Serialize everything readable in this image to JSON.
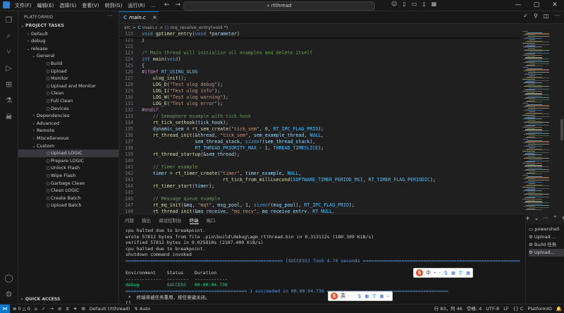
{
  "title_bar": {
    "menu": [
      "文件(F)",
      "编辑(E)",
      "选择(S)",
      "查看(V)",
      "转到(G)",
      "运行(R)",
      "..."
    ],
    "command_center": "rtthread"
  },
  "sidebar": {
    "title": "PLATFORMIO",
    "more": "···",
    "items": [
      {
        "label": "PROJECT TASKS",
        "chev": "⌄",
        "icon": "",
        "section": true
      },
      {
        "label": "Default",
        "chev": "›",
        "icon": ""
      },
      {
        "label": "debug",
        "chev": "›",
        "icon": ""
      },
      {
        "label": "release",
        "chev": "⌄",
        "icon": ""
      },
      {
        "label": "General",
        "chev": "⌄",
        "icon": ""
      },
      {
        "label": "Build",
        "chev": "",
        "icon": "○"
      },
      {
        "label": "Upload",
        "chev": "",
        "icon": "○"
      },
      {
        "label": "Monitor",
        "chev": "",
        "icon": "○"
      },
      {
        "label": "Upload and Monitor",
        "chev": "",
        "icon": "○"
      },
      {
        "label": "Clean",
        "chev": "",
        "icon": "○"
      },
      {
        "label": "Full Clean",
        "chev": "",
        "icon": "○"
      },
      {
        "label": "Devices",
        "chev": "",
        "icon": "○"
      },
      {
        "label": "Dependencies",
        "chev": "›",
        "icon": ""
      },
      {
        "label": "Advanced",
        "chev": "›",
        "icon": ""
      },
      {
        "label": "Remote",
        "chev": "›",
        "icon": ""
      },
      {
        "label": "Miscellaneous",
        "chev": "›",
        "icon": ""
      },
      {
        "label": "Custom",
        "chev": "⌄",
        "icon": ""
      },
      {
        "label": "Upload LOGIC",
        "chev": "",
        "icon": "○"
      },
      {
        "label": "Prepare LOGIC",
        "chev": "",
        "icon": "○"
      },
      {
        "label": "Unlock Flash",
        "chev": "",
        "icon": "○"
      },
      {
        "label": "Wipe Flash",
        "chev": "",
        "icon": "○"
      },
      {
        "label": "Garbage Clean",
        "chev": "",
        "icon": "○"
      },
      {
        "label": "Clean LOGIC",
        "chev": "",
        "icon": "○"
      },
      {
        "label": "Create Batch",
        "chev": "",
        "icon": "○"
      },
      {
        "label": "Upload Batch",
        "chev": "",
        "icon": "○"
      }
    ],
    "selected_index": 17,
    "quick_access": "QUICK ACCESS"
  },
  "editor": {
    "tab_label": "main.c",
    "tab_icon": "C",
    "tab_close": "×",
    "breadcrumb": {
      "folder": "src",
      "sep": ">",
      "file": "main.c",
      "symbol": "mq_receive_entry(void *)"
    },
    "lines": [
      {
        "n": "115",
        "segs": [
          [
            "kw",
            "void "
          ],
          [
            "fn",
            "gptimer_entry"
          ],
          [
            "tx",
            "("
          ],
          [
            "kw",
            "void "
          ],
          [
            "tx",
            "*"
          ],
          [
            "var",
            "parameter"
          ],
          [
            "tx",
            ")"
          ]
        ]
      },
      {
        "n": "121",
        "segs": [
          [
            "tx",
            "}"
          ]
        ]
      },
      {
        "n": "122",
        "segs": []
      },
      {
        "n": "123",
        "segs": [
          [
            "cm",
            "/* Main thread will initialize all examples and delete itself"
          ]
        ]
      },
      {
        "n": "124",
        "segs": [
          [
            "kw",
            "int "
          ],
          [
            "fn",
            "main"
          ],
          [
            "tx",
            "("
          ],
          [
            "kw",
            "void"
          ],
          [
            "tx",
            ")"
          ]
        ]
      },
      {
        "n": "125",
        "segs": [
          [
            "tx",
            "{"
          ]
        ]
      },
      {
        "n": "126",
        "segs": [
          [
            "pp",
            "#ifdef "
          ],
          [
            "mac",
            "RT_USING_ULOG"
          ]
        ]
      },
      {
        "n": "127",
        "segs": [
          [
            "tx",
            "    "
          ],
          [
            "fn",
            "ulog_init"
          ],
          [
            "tx",
            "();"
          ]
        ]
      },
      {
        "n": "128",
        "segs": [
          [
            "tx",
            "    "
          ],
          [
            "fn",
            "LOG_D"
          ],
          [
            "tx",
            "("
          ],
          [
            "str",
            "\"Test ulog debug\""
          ],
          [
            "tx",
            ");"
          ]
        ]
      },
      {
        "n": "129",
        "segs": [
          [
            "tx",
            "    "
          ],
          [
            "fn",
            "LOG_I"
          ],
          [
            "tx",
            "("
          ],
          [
            "str",
            "\"Test ulog info\""
          ],
          [
            "tx",
            ");"
          ]
        ]
      },
      {
        "n": "130",
        "segs": [
          [
            "tx",
            "    "
          ],
          [
            "fn",
            "LOG_W"
          ],
          [
            "tx",
            "("
          ],
          [
            "str",
            "\"Test ulog warning\""
          ],
          [
            "tx",
            ");"
          ]
        ]
      },
      {
        "n": "131",
        "segs": [
          [
            "tx",
            "    "
          ],
          [
            "fn",
            "LOG_E"
          ],
          [
            "tx",
            "("
          ],
          [
            "str",
            "\"Test ulog error\""
          ],
          [
            "tx",
            ");"
          ]
        ]
      },
      {
        "n": "132",
        "segs": [
          [
            "pp",
            "#endif"
          ]
        ]
      },
      {
        "n": "133",
        "segs": [
          [
            "tx",
            "    "
          ],
          [
            "cm",
            "// Semaphore example with tick hook"
          ]
        ]
      },
      {
        "n": "134",
        "segs": [
          [
            "tx",
            "    "
          ],
          [
            "fn",
            "rt_tick_sethook"
          ],
          [
            "tx",
            "("
          ],
          [
            "var",
            "tick_hook"
          ],
          [
            "tx",
            ");"
          ]
        ]
      },
      {
        "n": "135",
        "segs": [
          [
            "tx",
            "    "
          ],
          [
            "var",
            "dynamic_sem"
          ],
          [
            "tx",
            " = "
          ],
          [
            "fn",
            "rt_sem_create"
          ],
          [
            "tx",
            "("
          ],
          [
            "str",
            "\"tick_sem\""
          ],
          [
            "tx",
            ", "
          ],
          [
            "num",
            "0"
          ],
          [
            "tx",
            ", "
          ],
          [
            "mac",
            "RT_IPC_FLAG_PRIO"
          ],
          [
            "tx",
            ");"
          ]
        ]
      },
      {
        "n": "136",
        "segs": [
          [
            "tx",
            "    "
          ],
          [
            "fn",
            "rt_thread_init"
          ],
          [
            "tx",
            "(&"
          ],
          [
            "var",
            "thread"
          ],
          [
            "tx",
            ", "
          ],
          [
            "str",
            "\"tick_sem\""
          ],
          [
            "tx",
            ", "
          ],
          [
            "var",
            "sem_example_thread"
          ],
          [
            "tx",
            ", "
          ],
          [
            "mac",
            "NULL"
          ],
          [
            "tx",
            ","
          ]
        ]
      },
      {
        "n": "137",
        "segs": [
          [
            "tx",
            "                   "
          ],
          [
            "var",
            "sem_thread_stack"
          ],
          [
            "tx",
            ", "
          ],
          [
            "kw",
            "sizeof"
          ],
          [
            "tx",
            "("
          ],
          [
            "var",
            "sem_thread_stack"
          ],
          [
            "tx",
            "),"
          ]
        ]
      },
      {
        "n": "138",
        "segs": [
          [
            "tx",
            "                   "
          ],
          [
            "mac",
            "RT_THREAD_PRIORITY_MAX"
          ],
          [
            "tx",
            " - "
          ],
          [
            "num",
            "1"
          ],
          [
            "tx",
            ", "
          ],
          [
            "mac",
            "THREAD_TIMESLICE"
          ],
          [
            "tx",
            ");"
          ]
        ]
      },
      {
        "n": "139",
        "segs": [
          [
            "tx",
            "    "
          ],
          [
            "fn",
            "rt_thread_startup"
          ],
          [
            "tx",
            "(&"
          ],
          [
            "var",
            "sem_thread"
          ],
          [
            "tx",
            ");"
          ]
        ]
      },
      {
        "n": "140",
        "segs": []
      },
      {
        "n": "141",
        "segs": [
          [
            "tx",
            "    "
          ],
          [
            "cm",
            "// Timer example"
          ]
        ]
      },
      {
        "n": "142",
        "segs": [
          [
            "tx",
            "    "
          ],
          [
            "var",
            "timer"
          ],
          [
            "tx",
            " = "
          ],
          [
            "fn",
            "rt_timer_create"
          ],
          [
            "tx",
            "("
          ],
          [
            "str",
            "\"timer\""
          ],
          [
            "tx",
            ", "
          ],
          [
            "var",
            "timer_example"
          ],
          [
            "tx",
            ", "
          ],
          [
            "mac",
            "NULL"
          ],
          [
            "tx",
            ","
          ]
        ]
      },
      {
        "n": "143",
        "segs": [
          [
            "tx",
            "                             "
          ],
          [
            "fn",
            "rt_tick_from_millisecond"
          ],
          [
            "tx",
            "("
          ],
          [
            "mac",
            "SOFTWARE_TIMER_PERIOD_MS"
          ],
          [
            "tx",
            "), "
          ],
          [
            "mac",
            "RT_TIMER_FLAG_PERIODIC"
          ],
          [
            "tx",
            ");"
          ]
        ]
      },
      {
        "n": "144",
        "segs": [
          [
            "tx",
            "    "
          ],
          [
            "fn",
            "rt_timer_start"
          ],
          [
            "tx",
            "("
          ],
          [
            "var",
            "timer"
          ],
          [
            "tx",
            ");"
          ]
        ]
      },
      {
        "n": "145",
        "segs": []
      },
      {
        "n": "146",
        "segs": [
          [
            "tx",
            "    "
          ],
          [
            "cm",
            "// Message queue example"
          ]
        ]
      },
      {
        "n": "147",
        "segs": [
          [
            "tx",
            "    "
          ],
          [
            "fn",
            "rt_mq_init"
          ],
          [
            "tx",
            "(&"
          ],
          [
            "var",
            "mq"
          ],
          [
            "tx",
            ", "
          ],
          [
            "str",
            "\"mqt\""
          ],
          [
            "tx",
            ", "
          ],
          [
            "var",
            "msg_pool"
          ],
          [
            "tx",
            ", "
          ],
          [
            "num",
            "1"
          ],
          [
            "tx",
            ", "
          ],
          [
            "kw",
            "sizeof"
          ],
          [
            "tx",
            "("
          ],
          [
            "var",
            "msg_pool"
          ],
          [
            "tx",
            "), "
          ],
          [
            "mac",
            "RT_IPC_FLAG_PRIO"
          ],
          [
            "tx",
            ");"
          ]
        ]
      },
      {
        "n": "148",
        "segs": [
          [
            "tx",
            "    "
          ],
          [
            "fn",
            "rt_thread_init"
          ],
          [
            "tx",
            "(&"
          ],
          [
            "var",
            "mq_receive"
          ],
          [
            "tx",
            ", "
          ],
          [
            "str",
            "\"mq_recv\""
          ],
          [
            "tx",
            ", "
          ],
          [
            "var",
            "mq_receive_entry"
          ],
          [
            "tx",
            ", "
          ],
          [
            "mac",
            "RT_NULL"
          ],
          [
            "tx",
            ","
          ]
        ]
      }
    ]
  },
  "panel": {
    "tabs": [
      "问题",
      "输出",
      "调试控制台",
      "终端",
      "端口"
    ],
    "active_tab": 3,
    "terminal_lines": [
      {
        "t": "cpu halted due to breakpoint.",
        "c": ""
      },
      {
        "t": "wrote 57812 bytes from file .pio\\build\\debug\\agm_rtthread.bin in 0.313112s (180.309 KiB/s)",
        "c": ""
      },
      {
        "t": "verified 57812 bytes in 0.025810s (2187.409 KiB/s)",
        "c": ""
      },
      {
        "t": "cpu halted due to breakpoint.",
        "c": ""
      },
      {
        "t": "shutdown command invoked",
        "c": ""
      },
      {
        "t": "========================================================= [SUCCESS] Took 4.74 seconds =========================================================",
        "c": "sep"
      },
      {
        "t": "",
        "c": ""
      },
      {
        "t": "Environment    Status    Duration",
        "c": ""
      },
      {
        "t": "-------------  --------  ------------",
        "c": ""
      },
      {
        "t": "debug          SUCCESS   00:00:04.738",
        "c": "green"
      },
      {
        "t": "============================================ 1 succeeded in 00:00:04.738 ============================================",
        "c": "sep"
      },
      {
        "t": " *  终端将被任务重用，按任意键关闭。",
        "c": ""
      },
      {
        "t": "[]",
        "c": ""
      }
    ],
    "terminal_list": [
      "powershell",
      "Upload ...",
      "Build 任务",
      "Upload..."
    ],
    "selected_terminal": 3
  },
  "ime": {
    "toolbar1": {
      "logo": "S",
      "items": [
        "中",
        "•",
        "·",
        "🎙",
        "▦",
        "👕",
        "▦"
      ]
    },
    "toolbar2": {
      "logo": "S",
      "items": [
        "英",
        "·",
        "·",
        "🎙",
        "▦",
        "👕",
        "▦",
        "~"
      ]
    }
  },
  "status_bar": {
    "left": [
      "⊗ 0 △ 0",
      "⌂",
      "✓",
      "→",
      "⊘",
      "⧖",
      "✦",
      "⊞",
      "Default (rtthread)",
      "↯ Auto"
    ],
    "right": [
      "行 83，列 46",
      "空格: 4",
      "UTF-8",
      "LF",
      "{} C",
      "PlatformIO",
      "🔔"
    ]
  }
}
